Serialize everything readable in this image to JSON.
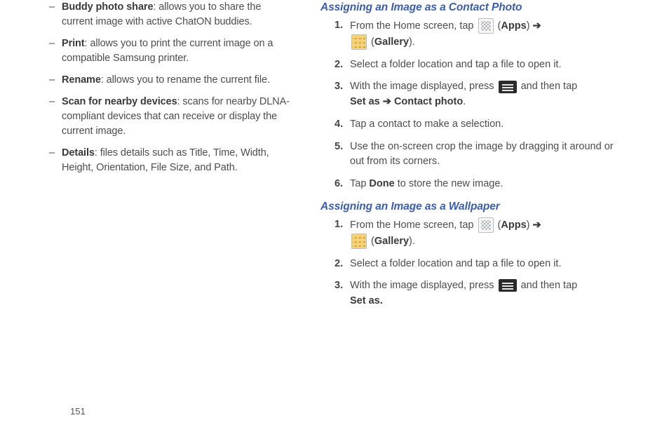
{
  "pageNumber": "151",
  "left": {
    "features": [
      {
        "term": "Buddy photo share",
        "desc": ": allows you to share the current image with active ChatON buddies."
      },
      {
        "term": "Print",
        "desc": ": allows you to print the current image on a compatible Samsung printer."
      },
      {
        "term": "Rename",
        "desc": ": allows you to rename the current file."
      },
      {
        "term": "Scan for nearby devices",
        "desc": ": scans for nearby DLNA-compliant devices that can receive or display the current image."
      },
      {
        "term": "Details",
        "desc": ": files details such as Title, Time, Width, Height, Orientation, File Size, and Path."
      }
    ]
  },
  "right": {
    "section1": {
      "title": "Assigning an Image as a Contact Photo",
      "step1a": "From the Home screen, tap ",
      "step1b": " (",
      "appsLabel": "Apps",
      "step1c": ") ",
      "arrow": "➔",
      "step1d": " (",
      "galleryLabel": "Gallery",
      "step1e": ").",
      "step2": "Select a folder location and tap a file to open it.",
      "step3a": "With the image displayed, press ",
      "step3b": " and then tap ",
      "setAs": "Set as",
      "contactPhoto": "Contact photo",
      "period": ".",
      "step4": "Tap a contact to make a selection.",
      "step5": "Use the on-screen crop the image by dragging it around or out from its corners.",
      "step6a": "Tap ",
      "done": "Done",
      "step6b": " to store the new image."
    },
    "section2": {
      "title": "Assigning an Image as a Wallpaper",
      "step1a": "From the Home screen, tap ",
      "step1b": " (",
      "appsLabel": "Apps",
      "step1c": ") ",
      "arrow": "➔",
      "step1d": " (",
      "galleryLabel": "Gallery",
      "step1e": ").",
      "step2": "Select a folder location and tap a file to open it.",
      "step3a": "With the image displayed, press ",
      "step3b": " and then tap ",
      "setAs": "Set as."
    }
  }
}
